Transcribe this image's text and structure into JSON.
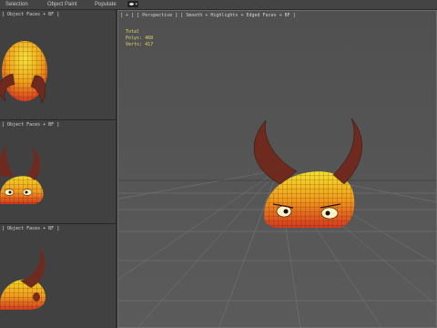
{
  "menu": {
    "selection": "Selection",
    "object_paint": "Object Paint",
    "populate": "Populate"
  },
  "viewports": {
    "top_left_label": "] Object Faces + BF ]",
    "mid_left_label": "] Object Faces + BF ]",
    "bot_left_label": "] Object Faces + BF ]",
    "perspective_label": "[ + ] [ Perspective ] [ Smooth + Highlights + Edged Faces + BF ]"
  },
  "stats": {
    "total_label": "Total",
    "polys_label": "Polys: 468",
    "verts_label": "Verts: 417"
  },
  "colors": {
    "body_top": "#f2d21c",
    "body_bottom": "#e0452a",
    "horn": "#6e2a1e",
    "grid": "#7a7a7a",
    "stats_text": "#e6d86a"
  },
  "icons": {
    "viewport_control": "eye-icon"
  }
}
